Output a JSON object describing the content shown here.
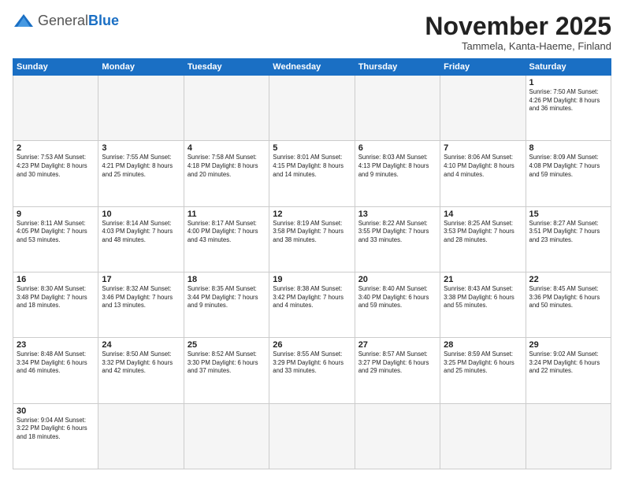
{
  "logo": {
    "general": "General",
    "blue": "Blue"
  },
  "header": {
    "month": "November 2025",
    "location": "Tammela, Kanta-Haeme, Finland"
  },
  "weekdays": [
    "Sunday",
    "Monday",
    "Tuesday",
    "Wednesday",
    "Thursday",
    "Friday",
    "Saturday"
  ],
  "weeks": [
    [
      {
        "day": "",
        "text": ""
      },
      {
        "day": "",
        "text": ""
      },
      {
        "day": "",
        "text": ""
      },
      {
        "day": "",
        "text": ""
      },
      {
        "day": "",
        "text": ""
      },
      {
        "day": "",
        "text": ""
      },
      {
        "day": "1",
        "text": "Sunrise: 7:50 AM\nSunset: 4:26 PM\nDaylight: 8 hours\nand 36 minutes."
      }
    ],
    [
      {
        "day": "2",
        "text": "Sunrise: 7:53 AM\nSunset: 4:23 PM\nDaylight: 8 hours\nand 30 minutes."
      },
      {
        "day": "3",
        "text": "Sunrise: 7:55 AM\nSunset: 4:21 PM\nDaylight: 8 hours\nand 25 minutes."
      },
      {
        "day": "4",
        "text": "Sunrise: 7:58 AM\nSunset: 4:18 PM\nDaylight: 8 hours\nand 20 minutes."
      },
      {
        "day": "5",
        "text": "Sunrise: 8:01 AM\nSunset: 4:15 PM\nDaylight: 8 hours\nand 14 minutes."
      },
      {
        "day": "6",
        "text": "Sunrise: 8:03 AM\nSunset: 4:13 PM\nDaylight: 8 hours\nand 9 minutes."
      },
      {
        "day": "7",
        "text": "Sunrise: 8:06 AM\nSunset: 4:10 PM\nDaylight: 8 hours\nand 4 minutes."
      },
      {
        "day": "8",
        "text": "Sunrise: 8:09 AM\nSunset: 4:08 PM\nDaylight: 7 hours\nand 59 minutes."
      }
    ],
    [
      {
        "day": "9",
        "text": "Sunrise: 8:11 AM\nSunset: 4:05 PM\nDaylight: 7 hours\nand 53 minutes."
      },
      {
        "day": "10",
        "text": "Sunrise: 8:14 AM\nSunset: 4:03 PM\nDaylight: 7 hours\nand 48 minutes."
      },
      {
        "day": "11",
        "text": "Sunrise: 8:17 AM\nSunset: 4:00 PM\nDaylight: 7 hours\nand 43 minutes."
      },
      {
        "day": "12",
        "text": "Sunrise: 8:19 AM\nSunset: 3:58 PM\nDaylight: 7 hours\nand 38 minutes."
      },
      {
        "day": "13",
        "text": "Sunrise: 8:22 AM\nSunset: 3:55 PM\nDaylight: 7 hours\nand 33 minutes."
      },
      {
        "day": "14",
        "text": "Sunrise: 8:25 AM\nSunset: 3:53 PM\nDaylight: 7 hours\nand 28 minutes."
      },
      {
        "day": "15",
        "text": "Sunrise: 8:27 AM\nSunset: 3:51 PM\nDaylight: 7 hours\nand 23 minutes."
      }
    ],
    [
      {
        "day": "16",
        "text": "Sunrise: 8:30 AM\nSunset: 3:48 PM\nDaylight: 7 hours\nand 18 minutes."
      },
      {
        "day": "17",
        "text": "Sunrise: 8:32 AM\nSunset: 3:46 PM\nDaylight: 7 hours\nand 13 minutes."
      },
      {
        "day": "18",
        "text": "Sunrise: 8:35 AM\nSunset: 3:44 PM\nDaylight: 7 hours\nand 9 minutes."
      },
      {
        "day": "19",
        "text": "Sunrise: 8:38 AM\nSunset: 3:42 PM\nDaylight: 7 hours\nand 4 minutes."
      },
      {
        "day": "20",
        "text": "Sunrise: 8:40 AM\nSunset: 3:40 PM\nDaylight: 6 hours\nand 59 minutes."
      },
      {
        "day": "21",
        "text": "Sunrise: 8:43 AM\nSunset: 3:38 PM\nDaylight: 6 hours\nand 55 minutes."
      },
      {
        "day": "22",
        "text": "Sunrise: 8:45 AM\nSunset: 3:36 PM\nDaylight: 6 hours\nand 50 minutes."
      }
    ],
    [
      {
        "day": "23",
        "text": "Sunrise: 8:48 AM\nSunset: 3:34 PM\nDaylight: 6 hours\nand 46 minutes."
      },
      {
        "day": "24",
        "text": "Sunrise: 8:50 AM\nSunset: 3:32 PM\nDaylight: 6 hours\nand 42 minutes."
      },
      {
        "day": "25",
        "text": "Sunrise: 8:52 AM\nSunset: 3:30 PM\nDaylight: 6 hours\nand 37 minutes."
      },
      {
        "day": "26",
        "text": "Sunrise: 8:55 AM\nSunset: 3:29 PM\nDaylight: 6 hours\nand 33 minutes."
      },
      {
        "day": "27",
        "text": "Sunrise: 8:57 AM\nSunset: 3:27 PM\nDaylight: 6 hours\nand 29 minutes."
      },
      {
        "day": "28",
        "text": "Sunrise: 8:59 AM\nSunset: 3:25 PM\nDaylight: 6 hours\nand 25 minutes."
      },
      {
        "day": "29",
        "text": "Sunrise: 9:02 AM\nSunset: 3:24 PM\nDaylight: 6 hours\nand 22 minutes."
      }
    ],
    [
      {
        "day": "30",
        "text": "Sunrise: 9:04 AM\nSunset: 3:22 PM\nDaylight: 6 hours\nand 18 minutes."
      },
      {
        "day": "",
        "text": ""
      },
      {
        "day": "",
        "text": ""
      },
      {
        "day": "",
        "text": ""
      },
      {
        "day": "",
        "text": ""
      },
      {
        "day": "",
        "text": ""
      },
      {
        "day": "",
        "text": ""
      }
    ]
  ]
}
